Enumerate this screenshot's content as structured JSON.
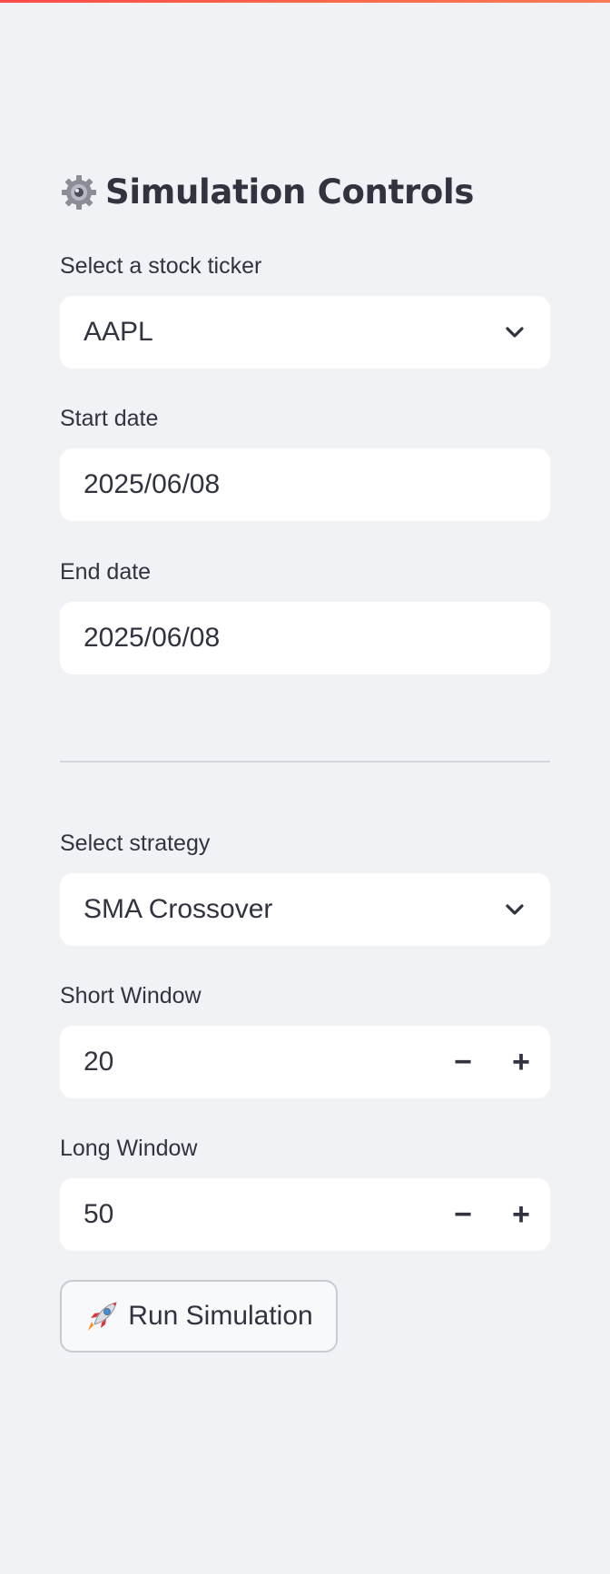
{
  "sidebar": {
    "title": "Simulation Controls",
    "title_icon": "gear-icon",
    "ticker": {
      "label": "Select a stock ticker",
      "value": "AAPL"
    },
    "start_date": {
      "label": "Start date",
      "value": "2025/06/08"
    },
    "end_date": {
      "label": "End date",
      "value": "2025/06/08"
    },
    "strategy": {
      "label": "Select strategy",
      "value": "SMA Crossover"
    },
    "short_window": {
      "label": "Short Window",
      "value": "20",
      "minus": "−",
      "plus": "+"
    },
    "long_window": {
      "label": "Long Window",
      "value": "50",
      "minus": "−",
      "plus": "+"
    },
    "run_button": {
      "label": "Run Simulation",
      "icon": "rocket-icon"
    }
  },
  "colors": {
    "background": "#f0f2f6",
    "accent": "#ff4b4b",
    "text": "#31333f",
    "field_bg": "#ffffff"
  }
}
